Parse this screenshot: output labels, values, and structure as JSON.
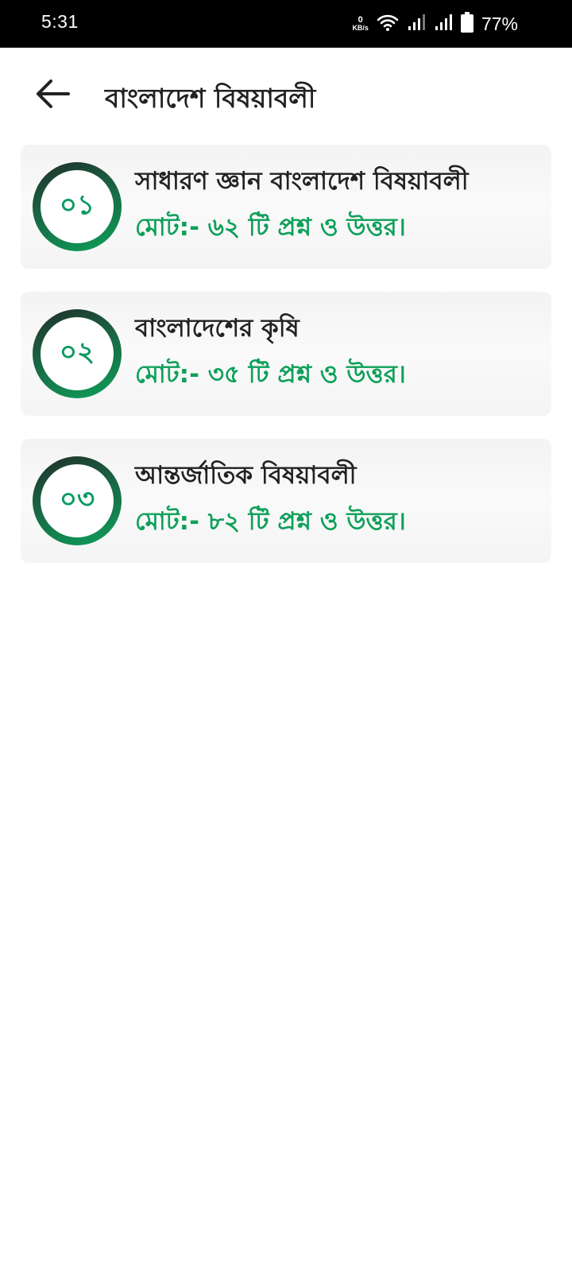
{
  "status_bar": {
    "time": "5:31",
    "net_speed_value": "0",
    "net_speed_unit": "KB/s",
    "battery": "77%",
    "icons": [
      "wifi-icon",
      "signal-icon",
      "signal-icon",
      "battery-icon"
    ]
  },
  "header": {
    "title": "বাংলাদেশ বিষয়াবলী",
    "back_icon": "arrow-left-icon"
  },
  "colors": {
    "accent": "#0ea05a",
    "badge_dark": "#1f2d28",
    "title_text": "#222222"
  },
  "items": [
    {
      "number": "০১",
      "title": "সাধারণ জ্ঞান বাংলাদেশ বিষয়াবলী",
      "subtitle": "মোট:- ৬২ টি প্রশ্ন ও উত্তর।"
    },
    {
      "number": "০২",
      "title": "বাংলাদেশের কৃষি",
      "subtitle": "মোট:- ৩৫ টি প্রশ্ন ও উত্তর।"
    },
    {
      "number": "০৩",
      "title": "আন্তর্জাতিক বিষয়াবলী",
      "subtitle": "মোট:- ৮২ টি প্রশ্ন ও উত্তর।"
    }
  ]
}
